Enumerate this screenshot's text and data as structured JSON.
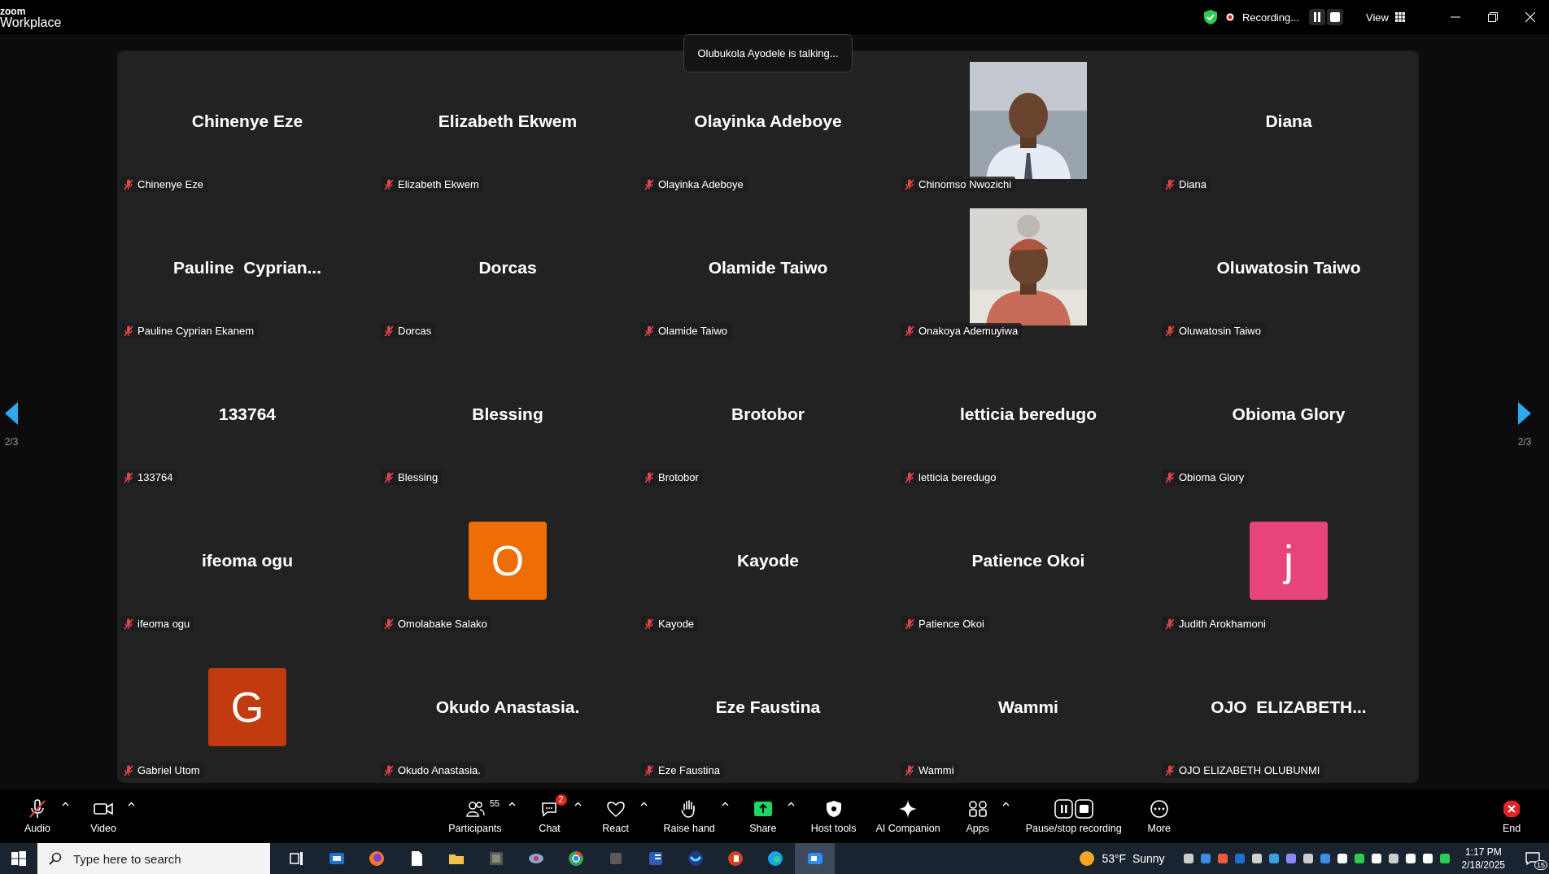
{
  "app": {
    "brand_small": "zoom",
    "brand": "Workplace"
  },
  "topbar": {
    "recording": "Recording...",
    "view": "View"
  },
  "notice": "Olubukola Ayodele is talking...",
  "pager": {
    "left": "2/3",
    "right": "2/3"
  },
  "tiles": [
    {
      "kind": "name",
      "display": "Chinenye Eze",
      "label": "Chinenye Eze"
    },
    {
      "kind": "name",
      "display": "Elizabeth Ekwem",
      "label": "Elizabeth Ekwem"
    },
    {
      "kind": "name",
      "display": "Olayinka Adeboye",
      "label": "Olayinka Adeboye"
    },
    {
      "kind": "picture",
      "label": "Chinomso Nwozichi"
    },
    {
      "kind": "name",
      "display": "Diana",
      "label": "Diana"
    },
    {
      "kind": "name",
      "display": "Pauline  Cyprian...",
      "label": "Pauline Cyprian Ekanem"
    },
    {
      "kind": "name",
      "display": "Dorcas",
      "label": "Dorcas"
    },
    {
      "kind": "name",
      "display": "Olamide Taiwo",
      "label": "Olamide Taiwo"
    },
    {
      "kind": "picture",
      "label": "Onakoya Ademuyiwa"
    },
    {
      "kind": "name",
      "display": "Oluwatosin Taiwo",
      "label": "Oluwatosin Taiwo"
    },
    {
      "kind": "name",
      "display": "133764",
      "label": "133764"
    },
    {
      "kind": "name",
      "display": "Blessing",
      "label": "Blessing"
    },
    {
      "kind": "name",
      "display": "Brotobor",
      "label": "Brotobor"
    },
    {
      "kind": "name",
      "display": "letticia beredugo",
      "label": "letticia beredugo"
    },
    {
      "kind": "name",
      "display": "Obioma Glory",
      "label": "Obioma Glory"
    },
    {
      "kind": "name",
      "display": "ifeoma ogu",
      "label": "ifeoma ogu"
    },
    {
      "kind": "avatar",
      "display": "O",
      "color": "#ee6d05",
      "label": "Omolabake Salako"
    },
    {
      "kind": "name",
      "display": "Kayode",
      "label": "Kayode"
    },
    {
      "kind": "name",
      "display": "Patience Okoi",
      "label": "Patience Okoi"
    },
    {
      "kind": "avatar",
      "display": "j",
      "color": "#e6447c",
      "label": "Judith Arokhamoni"
    },
    {
      "kind": "avatar",
      "display": "G",
      "color": "#c23a0f",
      "label": "Gabriel Utom"
    },
    {
      "kind": "name",
      "display": "Okudo Anastasia.",
      "label": "Okudo Anastasia."
    },
    {
      "kind": "name",
      "display": "Eze Faustina",
      "label": "Eze Faustina"
    },
    {
      "kind": "name",
      "display": "Wammi",
      "label": "Wammi"
    },
    {
      "kind": "name",
      "display": "OJO  ELIZABETH...",
      "label": "OJO ELIZABETH OLUBUNMI"
    }
  ],
  "toolbar": [
    {
      "kind": "audio",
      "label": "Audio",
      "caret": true
    },
    {
      "kind": "video",
      "label": "Video",
      "caret": true
    },
    {
      "kind": "gap"
    },
    {
      "kind": "participants",
      "label": "Participants",
      "count": "55",
      "caret": true
    },
    {
      "kind": "chat",
      "label": "Chat",
      "badge": "2",
      "caret": true
    },
    {
      "kind": "react",
      "label": "React",
      "caret": true
    },
    {
      "kind": "hand",
      "label": "Raise hand",
      "caret": true
    },
    {
      "kind": "share",
      "label": "Share",
      "caret": true
    },
    {
      "kind": "host",
      "label": "Host tools",
      "caret": false
    },
    {
      "kind": "ai",
      "label": "AI Companion",
      "caret": false
    },
    {
      "kind": "apps",
      "label": "Apps",
      "caret": true
    },
    {
      "kind": "record",
      "label": "Pause/stop recording",
      "caret": false
    },
    {
      "kind": "more",
      "label": "More",
      "caret": false
    },
    {
      "kind": "gap"
    },
    {
      "kind": "end",
      "label": "End",
      "caret": false
    }
  ],
  "taskbar": {
    "search_placeholder": "Type here to search",
    "weather": "53°F  Sunny",
    "time": "1:17 PM",
    "date": "2/18/2025",
    "notifications": "15"
  }
}
